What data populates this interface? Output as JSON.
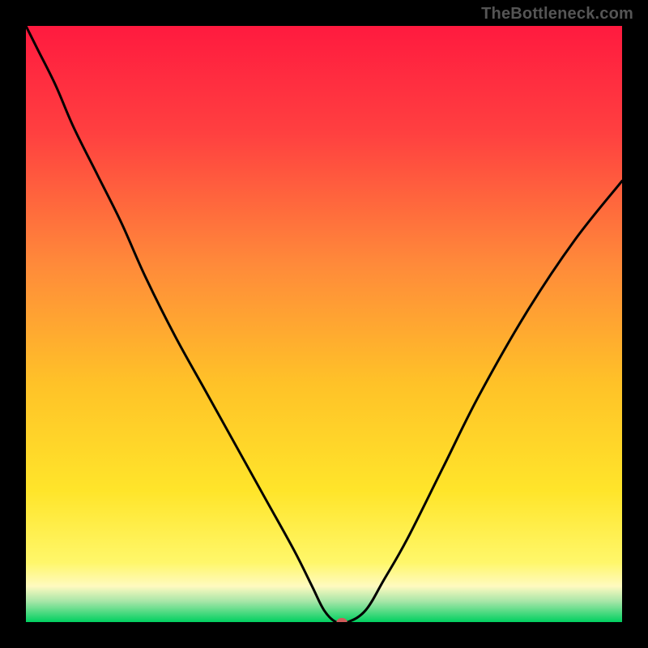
{
  "watermark": "TheBottleneck.com",
  "chart_data": {
    "type": "line",
    "title": "",
    "xlabel": "",
    "ylabel": "",
    "xlim": [
      0,
      100
    ],
    "ylim": [
      0,
      100
    ],
    "grid": false,
    "legend": false,
    "background_gradient": {
      "stops": [
        {
          "offset": 0.0,
          "color": "#ff1a3f"
        },
        {
          "offset": 0.18,
          "color": "#ff4040"
        },
        {
          "offset": 0.4,
          "color": "#ff8a3a"
        },
        {
          "offset": 0.6,
          "color": "#ffc228"
        },
        {
          "offset": 0.78,
          "color": "#ffe52a"
        },
        {
          "offset": 0.9,
          "color": "#fff76a"
        },
        {
          "offset": 0.94,
          "color": "#fffac0"
        },
        {
          "offset": 0.965,
          "color": "#a8e6a8"
        },
        {
          "offset": 1.0,
          "color": "#00d060"
        }
      ]
    },
    "series": [
      {
        "name": "bottleneck-curve",
        "color": "#000000",
        "x": [
          0,
          2,
          5,
          8,
          12,
          16,
          20,
          25,
          30,
          35,
          40,
          45,
          48,
          50,
          52,
          54,
          57,
          60,
          64,
          70,
          76,
          84,
          92,
          100
        ],
        "y": [
          100,
          96,
          90,
          83,
          75,
          67,
          58,
          48,
          39,
          30,
          21,
          12,
          6,
          2,
          0,
          0,
          2,
          7,
          14,
          26,
          38,
          52,
          64,
          74
        ]
      }
    ],
    "marker": {
      "name": "optimal-point",
      "x": 53,
      "y": 0,
      "color": "#d05a5a",
      "rx": 0.9,
      "ry": 0.7
    }
  }
}
